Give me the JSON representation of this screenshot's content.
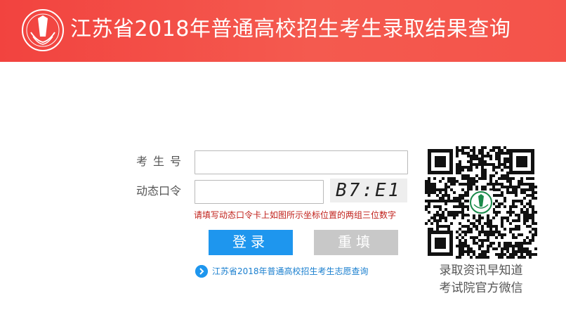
{
  "header": {
    "title": "江苏省2018年普通高校招生考生录取结果查询",
    "logo_icon": "exam-authority-logo"
  },
  "form": {
    "exam_number_label": "考生号",
    "exam_number_value": "",
    "dynamic_password_label": "动态口令",
    "dynamic_password_value": "",
    "captcha_text": "B7:E1",
    "hint": "请填写动态口令卡上如图所示坐标位置的两组三位数字",
    "login_label": "登录",
    "reset_label": "重填"
  },
  "link": {
    "icon": "chevron-right-circle-icon",
    "text": "江苏省2018年普通高校招生考生志愿查询"
  },
  "qr": {
    "icon": "wechat-qr-code",
    "caption_line1": "录取资讯早知道",
    "caption_line2": "考试院官方微信"
  },
  "colors": {
    "header_red": "#f2433f",
    "login_blue": "#1e96ee",
    "reset_gray": "#c8c8c8",
    "hint_red": "#c0201a"
  }
}
